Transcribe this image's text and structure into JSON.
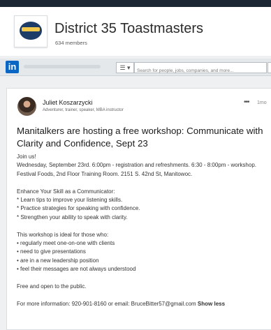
{
  "group": {
    "name": "District 35 Toastmasters",
    "members": "634 members"
  },
  "nav": {
    "logo_text": "in",
    "menu_icon": "☰ ▾",
    "search_placeholder": "Search for people, jobs, companies, and more..."
  },
  "post": {
    "author": "Juliet Koszarzycki",
    "headline": "Adventurer, trainer, speaker, MBA instructor",
    "more_icon": "•••",
    "time": "1mo",
    "title": "Manitalkers are hosting a free workshop: Communicate with Clarity and Confidence, Sept 23",
    "body": {
      "p1": "Join us!",
      "p2": "Wednesday, September 23rd. 6:00pm - registration and refreshments. 6:30 - 8:00pm - workshop.",
      "p3": "Festival Foods, 2nd Floor Training Room. 2151 S. 42nd St, Manitowoc.",
      "p4": "Enhance Your Skill as a Communicator:",
      "b1": "* Learn tips to improve your listening skills.",
      "b2": "* Practice strategies for speaking with confidence.",
      "b3": "* Strengthen your ability to speak with clarity.",
      "p5": "This workshop is ideal for those who:",
      "c1": "• regularly meet one-on-one with clients",
      "c2": "• need to give presentations",
      "c3": "• are in a new leadership position",
      "c4": "• feel their messages are not always understood",
      "p6": "Free and open to the public.",
      "contact": "For more information: 920-901-8160 or email: BruceBitter57@gmail.com",
      "show_less": "Show less"
    }
  }
}
